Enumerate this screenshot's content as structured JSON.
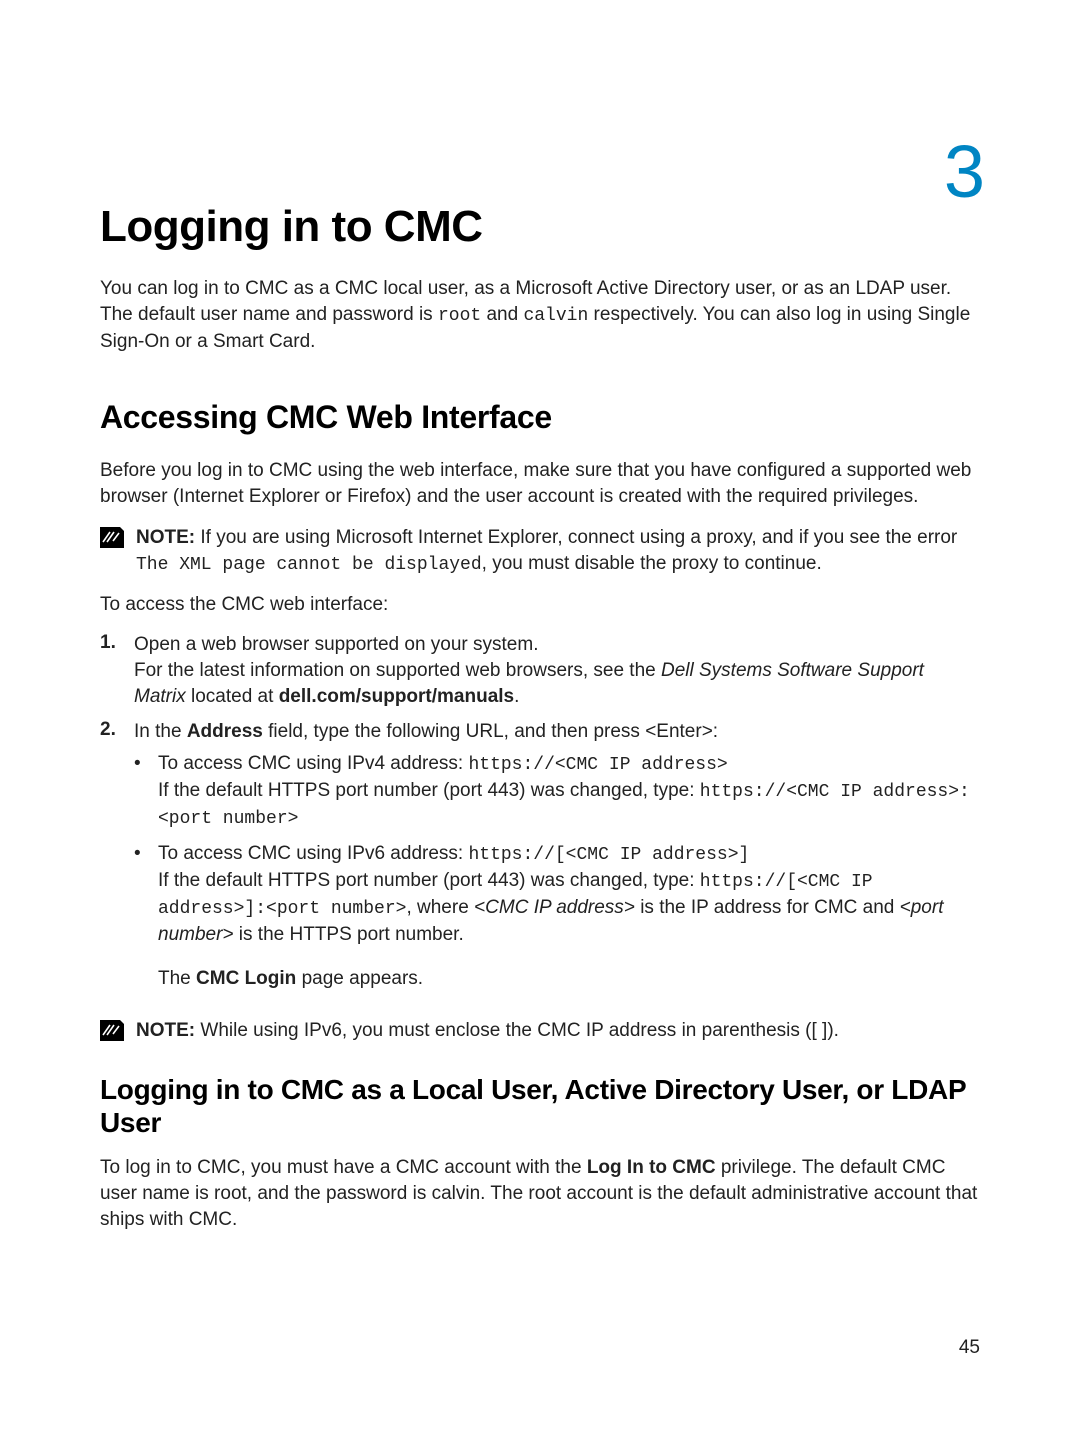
{
  "chapter_num": "3",
  "page_num": "45",
  "h1": "Logging in to CMC",
  "intro": {
    "p1a": "You can log in to CMC as a CMC local user, as a Microsoft Active Directory user, or as an LDAP user. The default user name and password is ",
    "u": "root",
    "p1b": " and ",
    "pw": "calvin",
    "p1c": " respectively. You can also log in using Single Sign-On or a Smart Card."
  },
  "h2": "Accessing CMC Web Interface",
  "access_intro": "Before you log in to CMC using the web interface, make sure that you have configured a supported web browser (Internet Explorer or Firefox) and the user account is created with the required privileges.",
  "note1": {
    "label": "NOTE:",
    "t1": " If you are using Microsoft Internet Explorer, connect using a proxy, and if you see the error ",
    "code": "The XML page cannot be displayed",
    "t2": ", you must disable the proxy to continue."
  },
  "access_lead": "To access the CMC web interface:",
  "step1": {
    "marker": "1.",
    "l1": "Open a web browser supported on your system.",
    "l2a": "For the latest information on supported web browsers, see the ",
    "l2i": "Dell Systems Software Support Matrix",
    "l2b": " located at ",
    "l2bold": "dell.com/support/manuals",
    "l2c": "."
  },
  "step2": {
    "marker": "2.",
    "l1a": "In the ",
    "l1bold": "Address",
    "l1b": " field, type the following URL, and then press <Enter>:",
    "b1": {
      "t1": "To access CMC using IPv4 address: ",
      "c1": "https://<CMC IP address>",
      "t2": "If the default HTTPS port number (port 443) was changed, type: ",
      "c2": "https://<CMC IP address>:<port number>"
    },
    "b2": {
      "t1": "To access CMC using IPv6 address: ",
      "c1": "https://[<CMC IP address>]",
      "t2": "If the default HTTPS port number (port 443) was changed, type: ",
      "c2": "https://[<CMC IP address>]:<port number>",
      "t3": ", where ",
      "i1": "<CMC IP address>",
      "t4": " is the IP address for CMC and ",
      "i2": "<port number>",
      "t5": " is the HTTPS port number."
    },
    "appears_a": "The ",
    "appears_b": "CMC Login",
    "appears_c": " page appears."
  },
  "note2": {
    "label": "NOTE:",
    "t1": " While using IPv6, you must enclose the CMC IP address in parenthesis ([ ])."
  },
  "h3": "Logging in to CMC as a Local User, Active Directory User, or LDAP User",
  "local": {
    "p1a": "To log in to CMC, you must have a CMC account with the ",
    "p1b": "Log In to CMC",
    "p1c": " privilege. The default CMC user name is root, and the password is calvin. The root account is the default administrative account that ships with CMC."
  }
}
